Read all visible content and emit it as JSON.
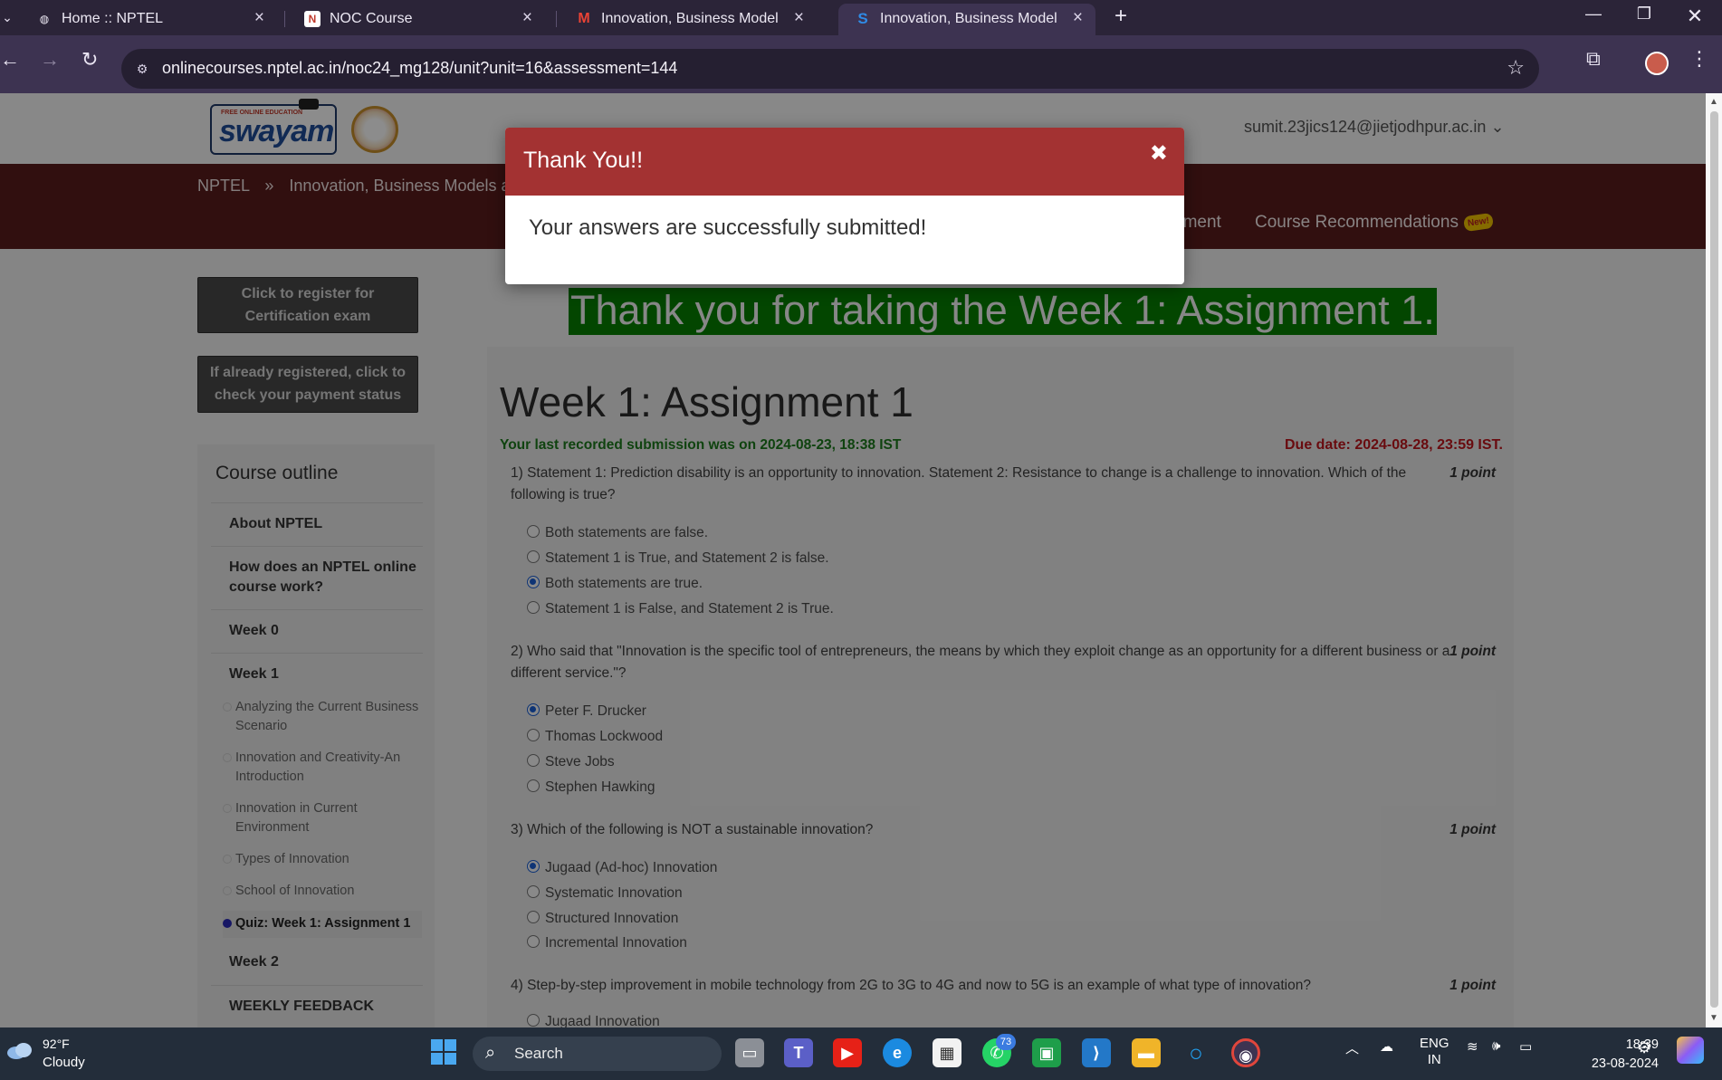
{
  "browser": {
    "tabs": [
      {
        "title": "Home :: NPTEL",
        "active": false
      },
      {
        "title": "NOC Course",
        "active": false
      },
      {
        "title": "Innovation, Business Models an",
        "active": false
      },
      {
        "title": "Innovation, Business Models an",
        "active": true
      }
    ],
    "url": "onlinecourses.nptel.ac.in/noc24_mg128/unit?unit=16&assessment=144"
  },
  "header": {
    "logo_text": "swayam",
    "logo_small": "FREE ONLINE EDUCATION",
    "user_email": "sumit.23jics124@jietjodhpur.ac.in",
    "user_caret": "⌄"
  },
  "nav": {
    "breadcrumb_root": "NPTEL",
    "breadcrumb_sep": "»",
    "breadcrumb_course": "Innovation, Business Models and",
    "link_partial": "nment",
    "link_recommendations": "Course Recommendations",
    "new_badge": "New!"
  },
  "sidebar": {
    "register_button": "Click to register for Certification exam",
    "payment_button": "If already registered, click to check your payment status",
    "outline_title": "Course outline",
    "items": [
      {
        "label": "About NPTEL"
      },
      {
        "label": "How does an NPTEL online course work?"
      },
      {
        "label": "Week 0"
      },
      {
        "label": "Week 1"
      }
    ],
    "subitems": [
      {
        "label": "Analyzing the Current Business Scenario"
      },
      {
        "label": "Innovation and Creativity-An Introduction"
      },
      {
        "label": "Innovation in Current Environment"
      },
      {
        "label": "Types of Innovation"
      },
      {
        "label": "School of Innovation"
      },
      {
        "label": "Quiz: Week 1: Assignment 1",
        "current": true
      }
    ],
    "items_after": [
      {
        "label": "Week 2"
      },
      {
        "label": "WEEKLY FEEDBACK"
      }
    ]
  },
  "main": {
    "thanks_banner": "Thank you for taking the Week 1: Assignment 1.",
    "title": "Week 1: Assignment 1",
    "last_submission": "Your last recorded submission was on 2024-08-23, 18:38 IST",
    "due_date": "Due date: 2024-08-28, 23:59 IST.",
    "questions": [
      {
        "text": "1)    Statement 1: Prediction disability is an opportunity to innovation. Statement 2: Resistance to change is a challenge to innovation. Which of the following is true?",
        "points": "1 point",
        "options": [
          "Both statements are false.",
          "Statement 1 is True, and Statement 2 is false.",
          "Both statements are true.",
          "Statement 1 is False, and Statement 2 is True."
        ],
        "selected": 2
      },
      {
        "text": "2)    Who said that \"Innovation is the specific tool of entrepreneurs, the means by which they exploit change as an opportunity for a different business or a different service.\"?",
        "points": "1 point",
        "options": [
          "Peter F. Drucker",
          "Thomas Lockwood",
          "Steve Jobs",
          "Stephen Hawking"
        ],
        "selected": 0
      },
      {
        "text": "3)    Which of the following is NOT a sustainable innovation?",
        "points": "1 point",
        "options": [
          "Jugaad (Ad-hoc) Innovation",
          "Systematic Innovation",
          "Structured Innovation",
          "Incremental Innovation"
        ],
        "selected": 0
      },
      {
        "text": "4)    Step-by-step improvement in mobile technology from 2G to 3G to 4G and now to 5G is an example of what type of innovation?",
        "points": "1 point",
        "options": [
          "Jugaad Innovation"
        ],
        "selected": -1
      }
    ]
  },
  "modal": {
    "title": "Thank You!!",
    "close_glyph": "✖",
    "message": "Your answers are successfully submitted!"
  },
  "taskbar": {
    "temperature": "92°F",
    "condition": "Cloudy",
    "search_label": "Search",
    "whatsapp_badge": "73",
    "language_top": "ENG",
    "language_bottom": "IN",
    "time": "18:39",
    "date": "23-08-2024"
  },
  "colors": {
    "accent_red": "#a33232",
    "nav_band": "#5a1d1d",
    "banner_green": "#068000",
    "due_red": "#c0141c",
    "submission_green": "#1d7a1d"
  }
}
